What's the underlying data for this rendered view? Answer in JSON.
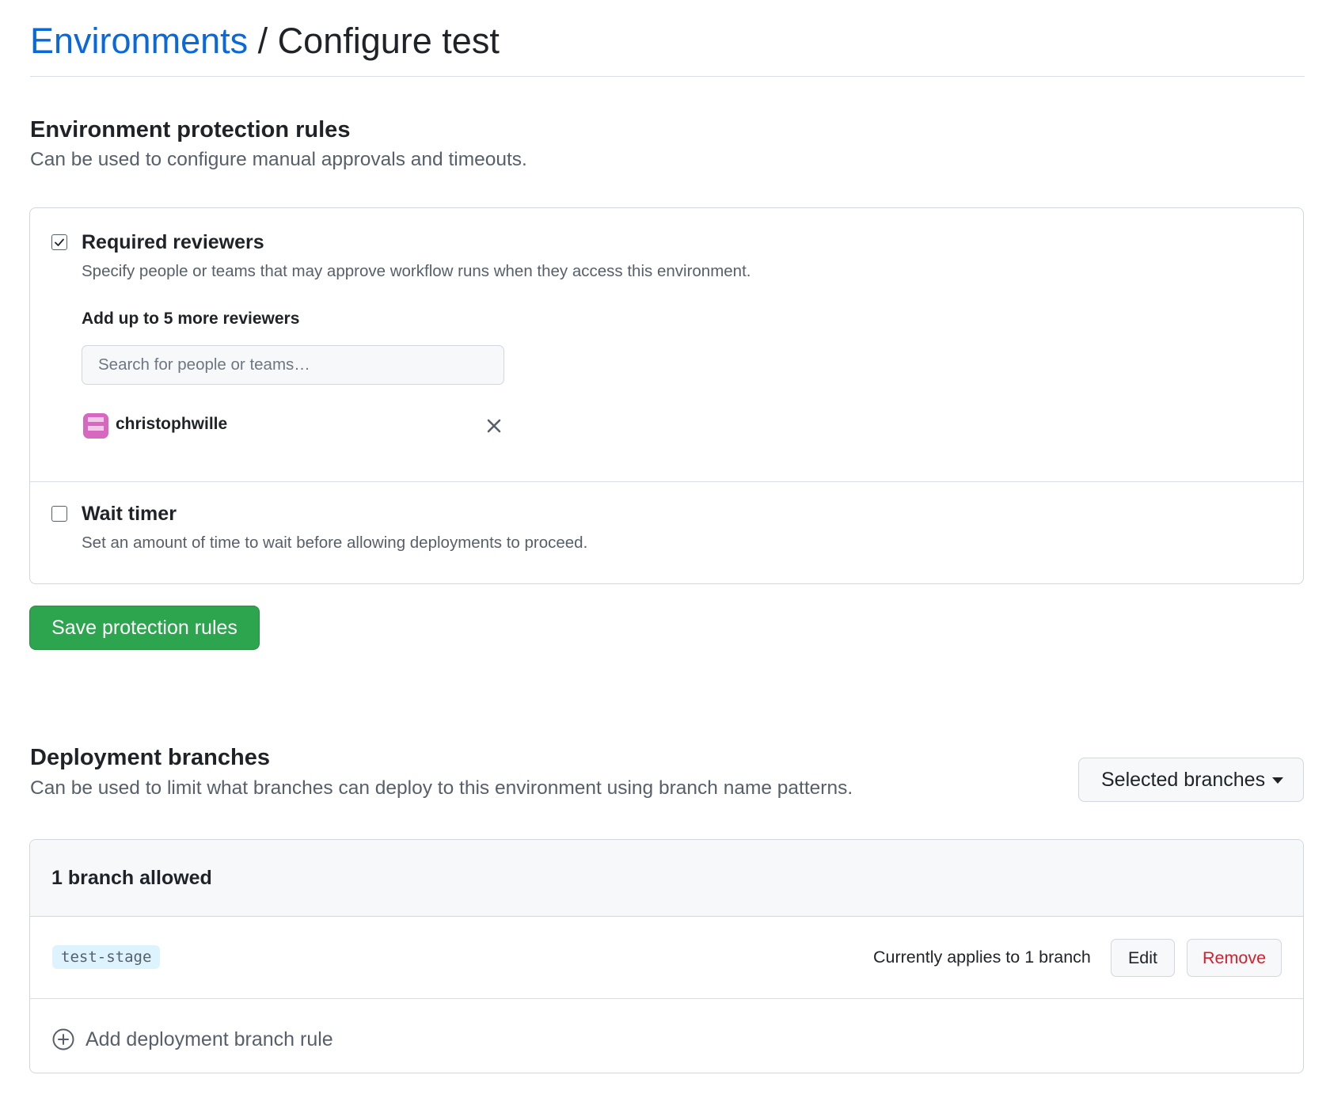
{
  "header": {
    "breadcrumb_link": "Environments",
    "separator": "/",
    "current": "Configure test"
  },
  "protection": {
    "title": "Environment protection rules",
    "description": "Can be used to configure manual approvals and timeouts.",
    "required_reviewers": {
      "checked": true,
      "title": "Required reviewers",
      "description": "Specify people or teams that may approve workflow runs when they access this environment.",
      "add_label": "Add up to 5 more reviewers",
      "search_placeholder": "Search for people or teams…",
      "reviewers": [
        {
          "name": "christophwille",
          "avatar_icon": "identicon-avatar"
        }
      ]
    },
    "wait_timer": {
      "checked": false,
      "title": "Wait timer",
      "description": "Set an amount of time to wait before allowing deployments to proceed."
    },
    "save_label": "Save protection rules"
  },
  "deployment": {
    "title": "Deployment branches",
    "description": "Can be used to limit what branches can deploy to this environment using branch name patterns.",
    "selector_value": "Selected branches",
    "allowed_count_label": "1 branch allowed",
    "rules": [
      {
        "pattern": "test-stage",
        "applies_text": "Currently applies to 1 branch",
        "edit_label": "Edit",
        "remove_label": "Remove"
      }
    ],
    "add_rule_label": "Add deployment branch rule"
  },
  "colors": {
    "link": "#0969da",
    "primary_button": "#2da44e",
    "danger": "#cf222e",
    "muted_text": "#57606a",
    "border": "#d0d7de"
  }
}
